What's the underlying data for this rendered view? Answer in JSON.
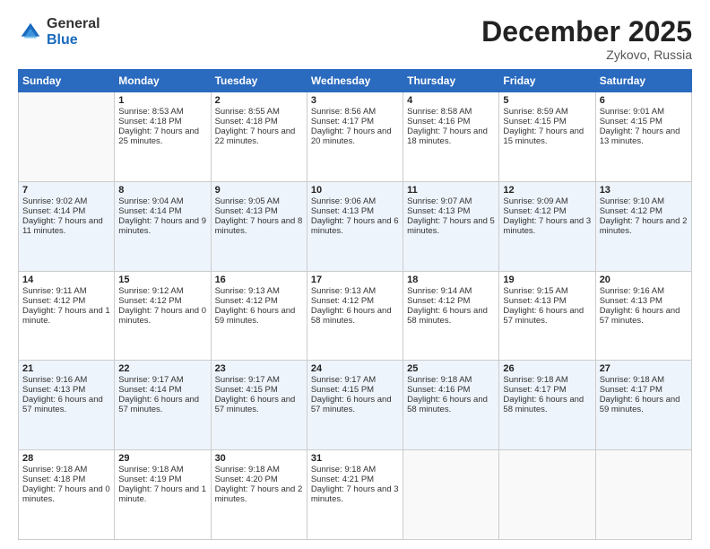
{
  "logo": {
    "general": "General",
    "blue": "Blue"
  },
  "header": {
    "month": "December 2025",
    "location": "Zykovo, Russia"
  },
  "days_of_week": [
    "Sunday",
    "Monday",
    "Tuesday",
    "Wednesday",
    "Thursday",
    "Friday",
    "Saturday"
  ],
  "weeks": [
    [
      {
        "day": "",
        "sunrise": "",
        "sunset": "",
        "daylight": ""
      },
      {
        "day": "1",
        "sunrise": "Sunrise: 8:53 AM",
        "sunset": "Sunset: 4:18 PM",
        "daylight": "Daylight: 7 hours and 25 minutes."
      },
      {
        "day": "2",
        "sunrise": "Sunrise: 8:55 AM",
        "sunset": "Sunset: 4:18 PM",
        "daylight": "Daylight: 7 hours and 22 minutes."
      },
      {
        "day": "3",
        "sunrise": "Sunrise: 8:56 AM",
        "sunset": "Sunset: 4:17 PM",
        "daylight": "Daylight: 7 hours and 20 minutes."
      },
      {
        "day": "4",
        "sunrise": "Sunrise: 8:58 AM",
        "sunset": "Sunset: 4:16 PM",
        "daylight": "Daylight: 7 hours and 18 minutes."
      },
      {
        "day": "5",
        "sunrise": "Sunrise: 8:59 AM",
        "sunset": "Sunset: 4:15 PM",
        "daylight": "Daylight: 7 hours and 15 minutes."
      },
      {
        "day": "6",
        "sunrise": "Sunrise: 9:01 AM",
        "sunset": "Sunset: 4:15 PM",
        "daylight": "Daylight: 7 hours and 13 minutes."
      }
    ],
    [
      {
        "day": "7",
        "sunrise": "Sunrise: 9:02 AM",
        "sunset": "Sunset: 4:14 PM",
        "daylight": "Daylight: 7 hours and 11 minutes."
      },
      {
        "day": "8",
        "sunrise": "Sunrise: 9:04 AM",
        "sunset": "Sunset: 4:14 PM",
        "daylight": "Daylight: 7 hours and 9 minutes."
      },
      {
        "day": "9",
        "sunrise": "Sunrise: 9:05 AM",
        "sunset": "Sunset: 4:13 PM",
        "daylight": "Daylight: 7 hours and 8 minutes."
      },
      {
        "day": "10",
        "sunrise": "Sunrise: 9:06 AM",
        "sunset": "Sunset: 4:13 PM",
        "daylight": "Daylight: 7 hours and 6 minutes."
      },
      {
        "day": "11",
        "sunrise": "Sunrise: 9:07 AM",
        "sunset": "Sunset: 4:13 PM",
        "daylight": "Daylight: 7 hours and 5 minutes."
      },
      {
        "day": "12",
        "sunrise": "Sunrise: 9:09 AM",
        "sunset": "Sunset: 4:12 PM",
        "daylight": "Daylight: 7 hours and 3 minutes."
      },
      {
        "day": "13",
        "sunrise": "Sunrise: 9:10 AM",
        "sunset": "Sunset: 4:12 PM",
        "daylight": "Daylight: 7 hours and 2 minutes."
      }
    ],
    [
      {
        "day": "14",
        "sunrise": "Sunrise: 9:11 AM",
        "sunset": "Sunset: 4:12 PM",
        "daylight": "Daylight: 7 hours and 1 minute."
      },
      {
        "day": "15",
        "sunrise": "Sunrise: 9:12 AM",
        "sunset": "Sunset: 4:12 PM",
        "daylight": "Daylight: 7 hours and 0 minutes."
      },
      {
        "day": "16",
        "sunrise": "Sunrise: 9:13 AM",
        "sunset": "Sunset: 4:12 PM",
        "daylight": "Daylight: 6 hours and 59 minutes."
      },
      {
        "day": "17",
        "sunrise": "Sunrise: 9:13 AM",
        "sunset": "Sunset: 4:12 PM",
        "daylight": "Daylight: 6 hours and 58 minutes."
      },
      {
        "day": "18",
        "sunrise": "Sunrise: 9:14 AM",
        "sunset": "Sunset: 4:12 PM",
        "daylight": "Daylight: 6 hours and 58 minutes."
      },
      {
        "day": "19",
        "sunrise": "Sunrise: 9:15 AM",
        "sunset": "Sunset: 4:13 PM",
        "daylight": "Daylight: 6 hours and 57 minutes."
      },
      {
        "day": "20",
        "sunrise": "Sunrise: 9:16 AM",
        "sunset": "Sunset: 4:13 PM",
        "daylight": "Daylight: 6 hours and 57 minutes."
      }
    ],
    [
      {
        "day": "21",
        "sunrise": "Sunrise: 9:16 AM",
        "sunset": "Sunset: 4:13 PM",
        "daylight": "Daylight: 6 hours and 57 minutes."
      },
      {
        "day": "22",
        "sunrise": "Sunrise: 9:17 AM",
        "sunset": "Sunset: 4:14 PM",
        "daylight": "Daylight: 6 hours and 57 minutes."
      },
      {
        "day": "23",
        "sunrise": "Sunrise: 9:17 AM",
        "sunset": "Sunset: 4:15 PM",
        "daylight": "Daylight: 6 hours and 57 minutes."
      },
      {
        "day": "24",
        "sunrise": "Sunrise: 9:17 AM",
        "sunset": "Sunset: 4:15 PM",
        "daylight": "Daylight: 6 hours and 57 minutes."
      },
      {
        "day": "25",
        "sunrise": "Sunrise: 9:18 AM",
        "sunset": "Sunset: 4:16 PM",
        "daylight": "Daylight: 6 hours and 58 minutes."
      },
      {
        "day": "26",
        "sunrise": "Sunrise: 9:18 AM",
        "sunset": "Sunset: 4:17 PM",
        "daylight": "Daylight: 6 hours and 58 minutes."
      },
      {
        "day": "27",
        "sunrise": "Sunrise: 9:18 AM",
        "sunset": "Sunset: 4:17 PM",
        "daylight": "Daylight: 6 hours and 59 minutes."
      }
    ],
    [
      {
        "day": "28",
        "sunrise": "Sunrise: 9:18 AM",
        "sunset": "Sunset: 4:18 PM",
        "daylight": "Daylight: 7 hours and 0 minutes."
      },
      {
        "day": "29",
        "sunrise": "Sunrise: 9:18 AM",
        "sunset": "Sunset: 4:19 PM",
        "daylight": "Daylight: 7 hours and 1 minute."
      },
      {
        "day": "30",
        "sunrise": "Sunrise: 9:18 AM",
        "sunset": "Sunset: 4:20 PM",
        "daylight": "Daylight: 7 hours and 2 minutes."
      },
      {
        "day": "31",
        "sunrise": "Sunrise: 9:18 AM",
        "sunset": "Sunset: 4:21 PM",
        "daylight": "Daylight: 7 hours and 3 minutes."
      },
      {
        "day": "",
        "sunrise": "",
        "sunset": "",
        "daylight": ""
      },
      {
        "day": "",
        "sunrise": "",
        "sunset": "",
        "daylight": ""
      },
      {
        "day": "",
        "sunrise": "",
        "sunset": "",
        "daylight": ""
      }
    ]
  ]
}
